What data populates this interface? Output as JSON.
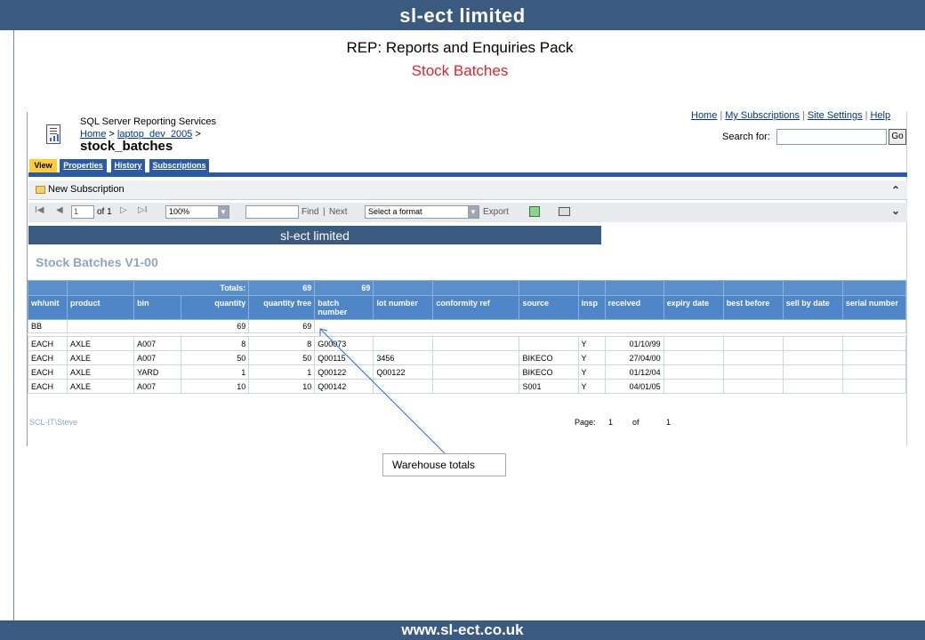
{
  "banner": {
    "brand": "sl-ect limited",
    "url": "www.sl-ect.co.uk"
  },
  "slide": {
    "title": "REP: Reports and Enquiries Pack",
    "subtitle": "Stock Batches"
  },
  "ssrs": {
    "app_name": "SQL Server Reporting Services",
    "breadcrumb": {
      "home": "Home",
      "sep": " > ",
      "folder": "laptop_dev_2005",
      "tail": " >"
    },
    "report_name": "stock_batches",
    "top_links": [
      "Home",
      "My Subscriptions",
      "Site Settings",
      "Help"
    ],
    "search_label": "Search for:",
    "search_value": "",
    "go_label": "Go",
    "tabs": [
      "View",
      "Properties",
      "History",
      "Subscriptions"
    ],
    "new_subscription": "New Subscription",
    "toolbar": {
      "first": "I◀",
      "prev": "◀",
      "page": "1",
      "of_pages": "of 1",
      "next": "▷",
      "last": "▷I",
      "zoom": "100%",
      "find": "Find",
      "sep": "|",
      "next_label": "Next",
      "format": "Select a format",
      "export": "Export"
    }
  },
  "report": {
    "banner": "sl-ect limited",
    "title": "Stock Batches V1-00",
    "totals_label": "Totals:",
    "totals_quantity": "69",
    "totals_free": "69",
    "columns": [
      "wh/unit",
      "product",
      "bin",
      "quantity",
      "quantity free",
      "batch number",
      "lot number",
      "conformity ref",
      "source",
      "insp",
      "received",
      "expiry date",
      "best before",
      "sell by date",
      "serial number"
    ],
    "warehouse": {
      "code": "BB",
      "quantity": "69",
      "free": "69"
    },
    "rows": [
      {
        "unit": "EACH",
        "product": "AXLE",
        "bin": "A007",
        "qty": "8",
        "free": "8",
        "batch": "G00073",
        "lot": "",
        "conf": "",
        "source": "",
        "insp": "Y",
        "received": "01/10/99"
      },
      {
        "unit": "EACH",
        "product": "AXLE",
        "bin": "A007",
        "qty": "50",
        "free": "50",
        "batch": "Q00115",
        "lot": "3456",
        "conf": "",
        "source": "BIKECO",
        "insp": "Y",
        "received": "27/04/00"
      },
      {
        "unit": "EACH",
        "product": "AXLE",
        "bin": "YARD",
        "qty": "1",
        "free": "1",
        "batch": "Q00122",
        "lot": "Q00122",
        "conf": "",
        "source": "BIKECO",
        "insp": "Y",
        "received": "01/12/04"
      },
      {
        "unit": "EACH",
        "product": "AXLE",
        "bin": "A007",
        "qty": "10",
        "free": "10",
        "batch": "Q00142",
        "lot": "",
        "conf": "",
        "source": "S001",
        "insp": "Y",
        "received": "04/01/05"
      }
    ],
    "user": "SCL-IT\\Steve",
    "page_label": "Page:",
    "page_current": "1",
    "page_of": "of",
    "page_total": "1"
  },
  "callout": "Warehouse  totals"
}
